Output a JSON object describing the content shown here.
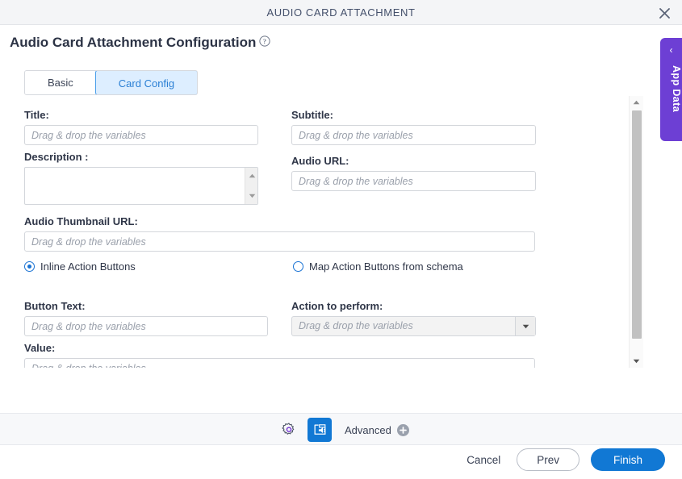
{
  "window": {
    "title": "AUDIO CARD ATTACHMENT",
    "close_icon": "close-icon"
  },
  "page": {
    "heading": "Audio Card Attachment Configuration",
    "help_icon": "help-circle-icon"
  },
  "tabs": [
    {
      "label": "Basic",
      "active": false
    },
    {
      "label": "Card Config",
      "active": true
    }
  ],
  "form": {
    "placeholder": "Drag & drop the variables",
    "fields": {
      "title": {
        "label": "Title:",
        "value": "",
        "placeholder": "Drag & drop the variables"
      },
      "subtitle": {
        "label": "Subtitle:",
        "value": "",
        "placeholder": "Drag & drop the variables"
      },
      "description": {
        "label": "Description :",
        "value": ""
      },
      "audio_url": {
        "label": "Audio URL:",
        "value": "",
        "placeholder": "Drag & drop the variables"
      },
      "audio_thumbnail_url": {
        "label": "Audio Thumbnail URL:",
        "value": "",
        "placeholder": "Drag & drop the variables"
      },
      "button_text": {
        "label": "Button Text:",
        "value": "",
        "placeholder": "Drag & drop the variables"
      },
      "action_to_perform": {
        "label": "Action to perform:",
        "value": "Drag & drop the variables",
        "arrow_icon": "chevron-down-icon"
      },
      "value": {
        "label": "Value:",
        "value": "",
        "placeholder": "Drag & drop the variables"
      }
    },
    "radios": [
      {
        "label": "Inline Action Buttons",
        "selected": true
      },
      {
        "label": "Map Action Buttons from schema",
        "selected": false
      }
    ]
  },
  "side_panel": {
    "label": "App Data",
    "chevron": "‹",
    "color": "#6d3fd4"
  },
  "toolbar": {
    "gear_icon": "gear-icon",
    "audio_card_icon": "audio-card-icon",
    "advanced_label": "Advanced",
    "advanced_add_icon": "plus-circle-icon",
    "accent": "#1178d4"
  },
  "actions": {
    "cancel": "Cancel",
    "prev": "Prev",
    "finish": "Finish"
  },
  "scrollbar": {
    "up_icon": "caret-up-icon",
    "down_icon": "caret-down-icon"
  }
}
